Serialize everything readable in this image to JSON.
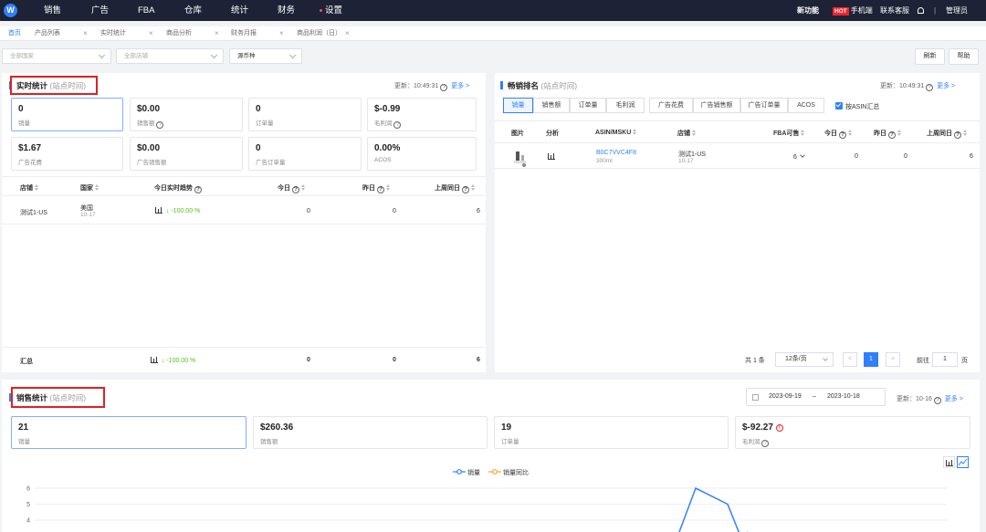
{
  "topnav": {
    "logo": "W",
    "items": [
      "销售",
      "广告",
      "FBA",
      "仓库",
      "统计",
      "财务",
      "设置"
    ],
    "new_feature": "新功能",
    "hot_badge": "HOT",
    "mobile": "手机端",
    "support": "联系客服",
    "divider": "|",
    "user": "管理员"
  },
  "tabs": [
    {
      "label": "首页",
      "active": true
    },
    {
      "label": "产品列表"
    },
    {
      "label": "实时统计"
    },
    {
      "label": "商品分析"
    },
    {
      "label": "财务月报"
    },
    {
      "label": "商品利润（日）"
    }
  ],
  "tab_close": "×",
  "filters": {
    "country_placeholder": "全部国家",
    "shop_placeholder": "全部店铺",
    "currency": "源币种",
    "refresh": "刷新",
    "help": "帮助"
  },
  "realtime": {
    "title": "实时统计",
    "subtitle": "(站点时间)",
    "update_label": "更新：",
    "update_time": "10:49:31",
    "more": "更多 >",
    "cards": [
      {
        "value": "0",
        "label": "销量",
        "selected": true
      },
      {
        "value": "$0.00",
        "label": "销售额",
        "q": true
      },
      {
        "value": "0",
        "label": "订单量"
      },
      {
        "value": "$-0.99",
        "label": "毛利润",
        "q": true
      },
      {
        "value": "$1.67",
        "label": "广告花费"
      },
      {
        "value": "$0.00",
        "label": "广告销售额"
      },
      {
        "value": "0",
        "label": "广告订单量"
      },
      {
        "value": "0.00%",
        "label": "ACOS"
      }
    ],
    "columns": [
      "店铺",
      "国家",
      "今日实时趋势",
      "今日",
      "昨日",
      "上周同日"
    ],
    "rows": [
      {
        "shop": "测试1-US",
        "country": "美国",
        "date": "10-17",
        "trend": "-100.00 %",
        "today": "0",
        "yesterday": "0",
        "last_week": "6"
      }
    ],
    "summary": {
      "label": "汇总",
      "trend": "-100.00 %",
      "today": "0",
      "yesterday": "0",
      "last_week": "6"
    }
  },
  "bestseller": {
    "title": "畅销排名",
    "subtitle": "(站点时间)",
    "update_label": "更新：",
    "update_time": "10:49:31",
    "more": "更多 >",
    "metric_tabs": [
      "销量",
      "销售额",
      "订单量",
      "毛利润"
    ],
    "ad_tabs": [
      "广告花费",
      "广告销售额",
      "广告订单量",
      "ACOS"
    ],
    "asin_checkbox": "按ASIN汇总",
    "columns": [
      "图片",
      "分析",
      "ASIN/MSKU",
      "店铺",
      "FBA可售",
      "今日",
      "昨日",
      "上周同日"
    ],
    "rows": [
      {
        "asin": "B0C7VVC4F8",
        "msku": "300ml",
        "shop": "测试1-US",
        "date": "10-17",
        "fba": "6",
        "today": "0",
        "yesterday": "0",
        "last_week": "6"
      }
    ],
    "pagination": {
      "total": "共 1 条",
      "page_size": "12条/页",
      "current": "1",
      "goto_label": "前往",
      "goto_value": "1",
      "page_suffix": "页"
    }
  },
  "sales": {
    "title": "销售统计",
    "subtitle": "(站点时间)",
    "date_from": "2023-09-19",
    "date_sep": "–",
    "date_to": "2023-10-18",
    "update_label": "更新：",
    "update_time": "10-16",
    "more": "更多 >",
    "cards": [
      {
        "value": "21",
        "label": "销量",
        "selected": true
      },
      {
        "value": "$260.36",
        "label": "销售额"
      },
      {
        "value": "19",
        "label": "订单量"
      },
      {
        "value": "$-92.27",
        "label": "毛利润",
        "q": true,
        "warn": true
      }
    ],
    "legend": [
      "销量",
      "销量同比"
    ],
    "colors": {
      "series1": "#2f7fff",
      "series2": "#f5a623",
      "accent": "#2f7fff",
      "annotation": "#e02020"
    }
  },
  "chart_data": {
    "type": "line",
    "series": [
      {
        "name": "销量",
        "values": [
          6,
          5,
          3
        ]
      },
      {
        "name": "销量同比",
        "values": []
      }
    ],
    "y_ticks": [
      "6",
      "5",
      "4"
    ],
    "ylim": [
      3,
      6
    ]
  }
}
